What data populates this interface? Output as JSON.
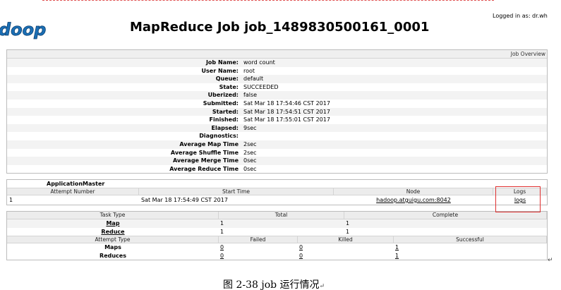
{
  "login_text": "Logged in as: dr.who",
  "logo_text": "doop",
  "page_title": "MapReduce Job job_1489830500161_0001",
  "overview": {
    "header": "Job Overview",
    "rows": [
      {
        "label": "Job Name:",
        "value": "word count"
      },
      {
        "label": "User Name:",
        "value": "root"
      },
      {
        "label": "Queue:",
        "value": "default"
      },
      {
        "label": "State:",
        "value": "SUCCEEDED"
      },
      {
        "label": "Uberized:",
        "value": "false"
      },
      {
        "label": "Submitted:",
        "value": "Sat Mar 18 17:54:46 CST 2017"
      },
      {
        "label": "Started:",
        "value": "Sat Mar 18 17:54:51 CST 2017"
      },
      {
        "label": "Finished:",
        "value": "Sat Mar 18 17:55:01 CST 2017"
      },
      {
        "label": "Elapsed:",
        "value": "9sec"
      },
      {
        "label": "Diagnostics:",
        "value": ""
      },
      {
        "label": "Average Map Time",
        "value": "2sec"
      },
      {
        "label": "Average Shuffle Time",
        "value": "2sec"
      },
      {
        "label": "Average Merge Time",
        "value": "0sec"
      },
      {
        "label": "Average Reduce Time",
        "value": "0sec"
      }
    ]
  },
  "app_master": {
    "title": "ApplicationMaster",
    "columns": [
      "Attempt Number",
      "Start Time",
      "Node",
      "Logs"
    ],
    "row": {
      "attempt": "1",
      "start": "Sat Mar 18 17:54:49 CST 2017",
      "node": "hadoop.atguigu.com:8042",
      "logs": "logs"
    }
  },
  "tasks": {
    "columns": [
      "Task Type",
      "Total",
      "Complete"
    ],
    "rows": [
      {
        "type": "Map",
        "total": "1",
        "complete": "1"
      },
      {
        "type": "Reduce",
        "total": "1",
        "complete": "1"
      }
    ]
  },
  "attempts": {
    "columns": [
      "Attempt Type",
      "Failed",
      "Killed",
      "Successful"
    ],
    "rows": [
      {
        "type": "Maps",
        "failed": "0",
        "killed": "0",
        "successful": "1"
      },
      {
        "type": "Reduces",
        "failed": "0",
        "killed": "0",
        "successful": "1"
      }
    ]
  },
  "caption": "图 2-38 job 运行情况",
  "caption_mark": "↵",
  "para_mark": "↵",
  "colors": {
    "highlight": "#e03030",
    "header_bg": "#ececec",
    "logo_blue": "#1b6fb5"
  }
}
